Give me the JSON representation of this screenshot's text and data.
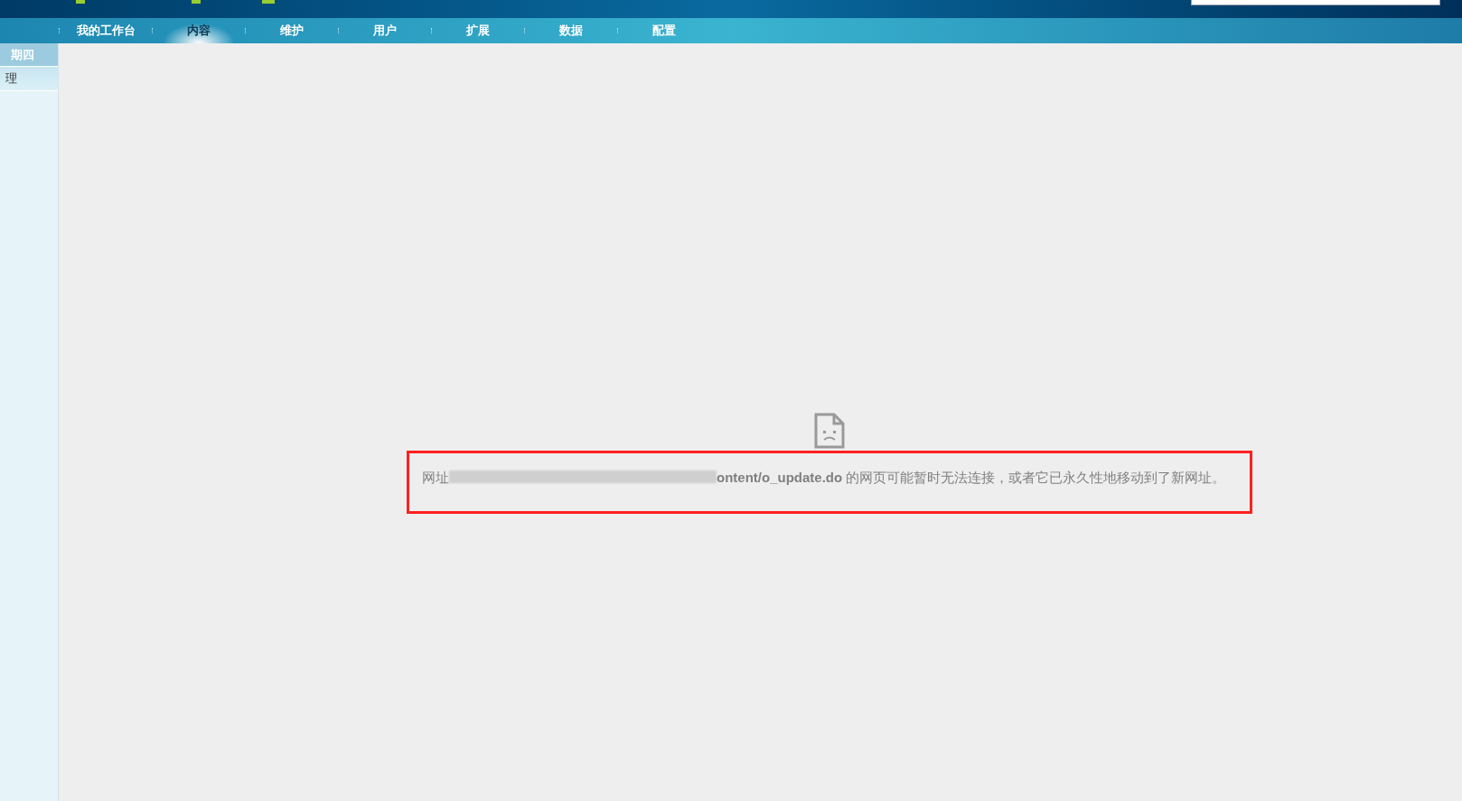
{
  "nav": [
    {
      "label": "我的工作台",
      "selected": false
    },
    {
      "label": "内容",
      "selected": true
    },
    {
      "label": "维护",
      "selected": false
    },
    {
      "label": "用户",
      "selected": false
    },
    {
      "label": "扩展",
      "selected": false
    },
    {
      "label": "数据",
      "selected": false
    },
    {
      "label": "配置",
      "selected": false
    }
  ],
  "sidebar": [
    {
      "label": "期四",
      "selected": true
    },
    {
      "label": "理",
      "selected": false
    }
  ],
  "error": {
    "prefix": "网址",
    "message": "**ontent/o_update.do** 的网页可能暂时无法连接，或者它已永久性地移动到了新网址。"
  }
}
